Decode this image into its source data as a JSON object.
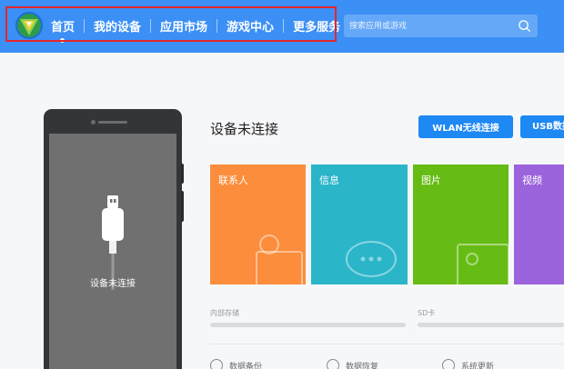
{
  "header": {
    "nav": [
      {
        "label": "首页"
      },
      {
        "label": "我的设备"
      },
      {
        "label": "应用市场"
      },
      {
        "label": "游戏中心"
      },
      {
        "label": "更多服务"
      }
    ],
    "search": {
      "placeholder": "搜索应用或游戏"
    }
  },
  "phone": {
    "status": "设备未连接"
  },
  "main": {
    "title": "设备未连接",
    "wlan_button": "WLAN无线连接",
    "usb_button": "USB数据线连接",
    "tiles": [
      {
        "label": "联系人",
        "color": "#fb8d3c"
      },
      {
        "label": "信息",
        "color": "#2ab5c9"
      },
      {
        "label": "图片",
        "color": "#66bc14"
      },
      {
        "label": "视频",
        "color": "#9b64dc"
      }
    ],
    "storage": [
      {
        "label": "内部存储"
      },
      {
        "label": "SD卡"
      }
    ],
    "bottom_actions": [
      {
        "label": "数据备份"
      },
      {
        "label": "数据恢复"
      },
      {
        "label": "系统更新"
      }
    ]
  },
  "colors": {
    "header": "#3b8ff5",
    "accent": "#1e88f3",
    "highlight": "#e5262c"
  }
}
